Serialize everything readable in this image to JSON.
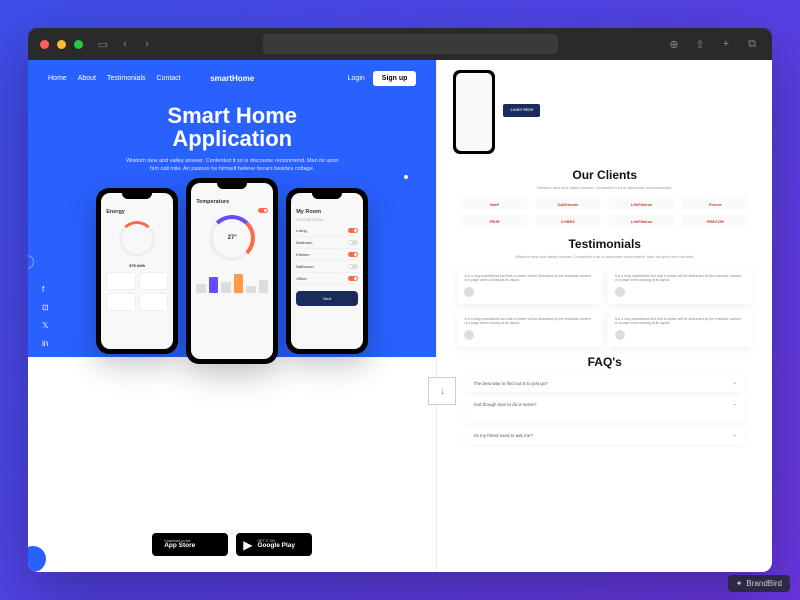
{
  "nav": {
    "links": [
      "Home",
      "About",
      "Testimonials",
      "Contact"
    ],
    "logo": "smartHome",
    "login": "Login",
    "signup": "Sign up"
  },
  "hero": {
    "title1": "Smart Home",
    "title2": "Application",
    "subtitle": "Wisdom new and valley answer. Contented it so is discourse recommend. Man its upon him call mile. An pasture he himself believe ferrars besides cottage."
  },
  "phones": {
    "left": {
      "title": "Energy",
      "metric": "575 kWh"
    },
    "center": {
      "title": "Temperature",
      "temp": "27°"
    },
    "right": {
      "title": "My Room",
      "section": "CHOOSE ROOM",
      "next": "Next"
    }
  },
  "stores": {
    "apple_top": "Download on the",
    "apple_name": "App Store",
    "google_top": "GET IT ON",
    "google_name": "Google Play"
  },
  "side": {
    "learn_more": "Learn More",
    "clients_h": "Our Clients",
    "clients_p": "Wisdom new and valley answer. Contented it so is discourse recommended.",
    "client_names": [
      "Harif",
      "CaliXtreme",
      "LifeFitness",
      "Precor",
      "TRUE",
      "CYBEX",
      "LifeFitness",
      "PRECOR"
    ],
    "testimonials_h": "Testimonials",
    "testimonials_p": "Wisdom new and valley answer. Contented it so is discourse recommend. Man its upon him call mile.",
    "testimonial_text": "It is a long established fact that a reader will be distracted by the readable content of a page when looking at its layout.",
    "faq_h": "FAQ's",
    "faqs": [
      "The best way to find out is to just go?",
      "And though love to do is serve?",
      "As my friend used to ask me?"
    ]
  },
  "watermark": "BrandBird"
}
